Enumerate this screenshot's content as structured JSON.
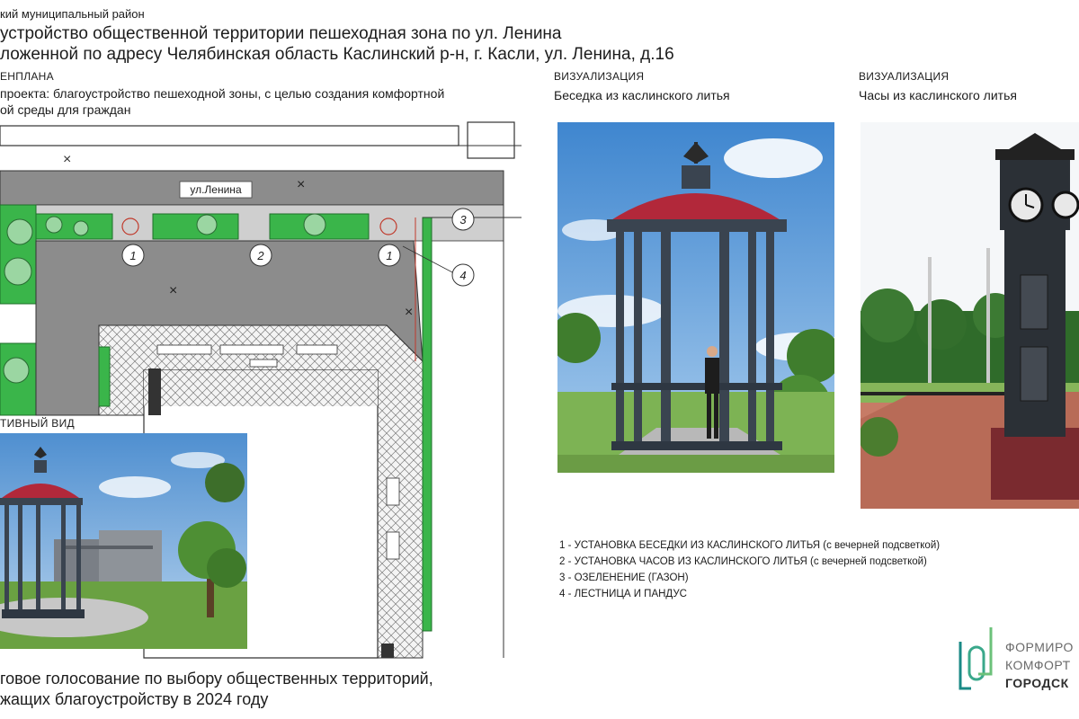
{
  "header": {
    "district": "кий муниципальный район",
    "title_line1": "устройство общественной территории пешеходная зона по ул. Ленина",
    "title_line2": "ложенной по адресу Челябинская область Каслинский р-н, г. Касли, ул. Ленина, д.16"
  },
  "plan": {
    "label": "ЕНПЛАНА",
    "goal_line1": "проекта: благоустройство пешеходной зоны, с целью создания комфортной",
    "goal_line2": "ой среды для граждан",
    "street_label": "ул.Ленина",
    "markers": [
      "1",
      "2",
      "1",
      "3",
      "4"
    ]
  },
  "perspective": {
    "label": "ТИВНЫЙ ВИД"
  },
  "viz1": {
    "label": "ВИЗУАЛИЗАЦИЯ",
    "caption": "Беседка из каслинского литья"
  },
  "viz2": {
    "label": "ВИЗУАЛИЗАЦИЯ",
    "caption": "Часы из каслинского литья"
  },
  "legend": [
    "1 - УСТАНОВКА БЕСЕДКИ ИЗ КАСЛИНСКОГО ЛИТЬЯ (с вечерней подсветкой)",
    "2 - УСТАНОВКА ЧАСОВ ИЗ КАСЛИНСКОГО ЛИТЬЯ (с вечерней подсветкой)",
    "3 - ОЗЕЛЕНЕНИЕ (ГАЗОН)",
    "4 - ЛЕСТНИЦА И ПАНДУС"
  ],
  "footer": {
    "line1": "говое голосование по выбору общественных территорий,",
    "line2": "жащих благоустройству в 2024 году"
  },
  "brand": {
    "line1": "ФОРМИРО",
    "line2": "КОМФОРТ",
    "line3": "ГОРОДСК"
  },
  "colors": {
    "accent_green": "#3ab54a",
    "road_gray": "#8c8c8c",
    "roof_red": "#b2283a",
    "brand_teal": "#1a8a86"
  }
}
